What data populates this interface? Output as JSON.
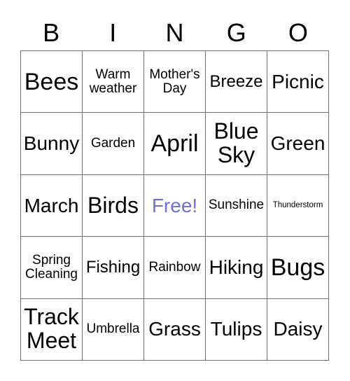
{
  "card": {
    "header": {
      "letters": [
        "B",
        "I",
        "N",
        "G",
        "O"
      ]
    },
    "free_color": "#6b72e0",
    "border_color": "#6f6f6f",
    "background_color": "#ffffff",
    "text_color": "#000000",
    "rows": [
      [
        {
          "label": "Bees",
          "size": "xxl",
          "free": false
        },
        {
          "label": "Warm\nweather",
          "size": "sm",
          "free": false
        },
        {
          "label": "Mother's\nDay",
          "size": "sm",
          "free": false
        },
        {
          "label": "Breeze",
          "size": "md",
          "free": false
        },
        {
          "label": "Picnic",
          "size": "lg",
          "free": false
        }
      ],
      [
        {
          "label": "Bunny",
          "size": "lg",
          "free": false
        },
        {
          "label": "Garden",
          "size": "sm",
          "free": false
        },
        {
          "label": "April",
          "size": "xxl",
          "free": false
        },
        {
          "label": "Blue\nSky",
          "size": "xl",
          "free": false
        },
        {
          "label": "Green",
          "size": "lg",
          "free": false
        }
      ],
      [
        {
          "label": "March",
          "size": "lg",
          "free": false
        },
        {
          "label": "Birds",
          "size": "xl",
          "free": false
        },
        {
          "label": "Free!",
          "size": "lg",
          "free": true
        },
        {
          "label": "Sunshine",
          "size": "sm",
          "free": false
        },
        {
          "label": "Thunderstorm",
          "size": "xs",
          "free": false
        }
      ],
      [
        {
          "label": "Spring\nCleaning",
          "size": "sm",
          "free": false
        },
        {
          "label": "Fishing",
          "size": "md",
          "free": false
        },
        {
          "label": "Rainbow",
          "size": "sm",
          "free": false
        },
        {
          "label": "Hiking",
          "size": "lg",
          "free": false
        },
        {
          "label": "Bugs",
          "size": "xxl",
          "free": false
        }
      ],
      [
        {
          "label": "Track\nMeet",
          "size": "xl",
          "free": false
        },
        {
          "label": "Umbrella",
          "size": "sm",
          "free": false
        },
        {
          "label": "Grass",
          "size": "lg",
          "free": false
        },
        {
          "label": "Tulips",
          "size": "lg",
          "free": false
        },
        {
          "label": "Daisy",
          "size": "lg",
          "free": false
        }
      ]
    ]
  }
}
